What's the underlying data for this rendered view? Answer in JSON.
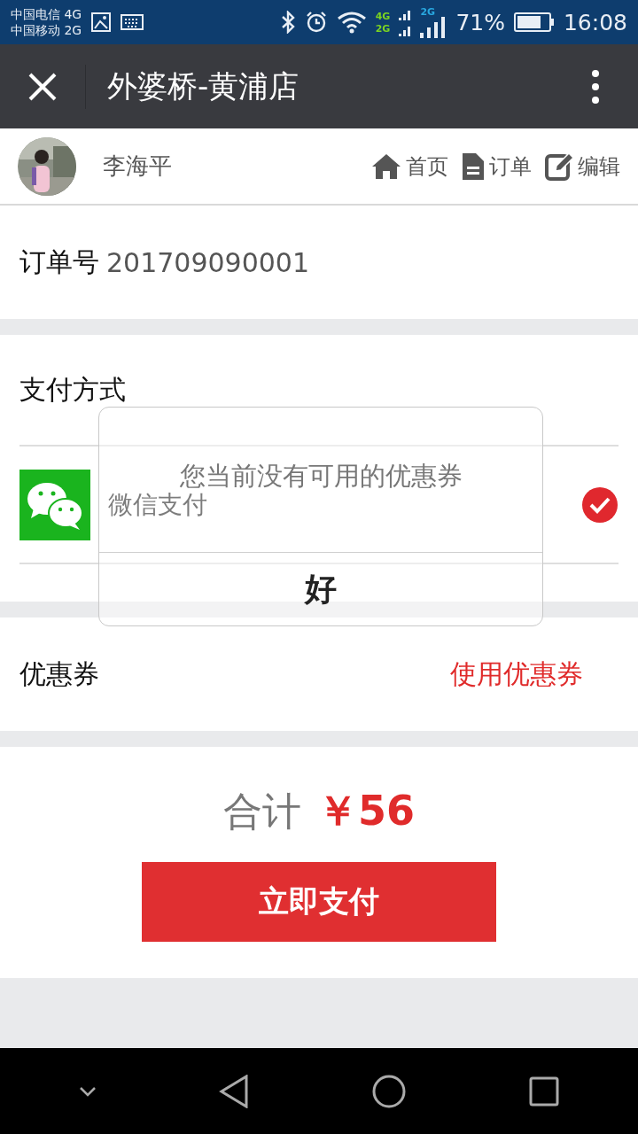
{
  "status_bar": {
    "carriers": [
      {
        "name": "中国电信",
        "network": "4G"
      },
      {
        "name": "中国移动",
        "network": "2G"
      }
    ],
    "sim1_label": "4G",
    "sim2_label": "2G",
    "sim2_top_label": "2G",
    "battery": "71%",
    "time": "16:08"
  },
  "title_bar": {
    "title": "外婆桥-黄浦店"
  },
  "user_bar": {
    "name": "李海平",
    "links": [
      {
        "kind": "home",
        "label": "首页"
      },
      {
        "kind": "orders",
        "label": "订单"
      },
      {
        "kind": "edit",
        "label": "编辑"
      }
    ]
  },
  "order": {
    "label": "订单号",
    "number": "201709090001"
  },
  "payment": {
    "title": "支付方式",
    "methods": [
      {
        "name": "微信支付",
        "selected": true
      }
    ]
  },
  "coupon": {
    "label": "优惠券",
    "action": "使用优惠券"
  },
  "total": {
    "label": "合计",
    "amount": "￥56",
    "button": "立即支付"
  },
  "dialog": {
    "message": "您当前没有可用的优惠券",
    "button": "好"
  }
}
